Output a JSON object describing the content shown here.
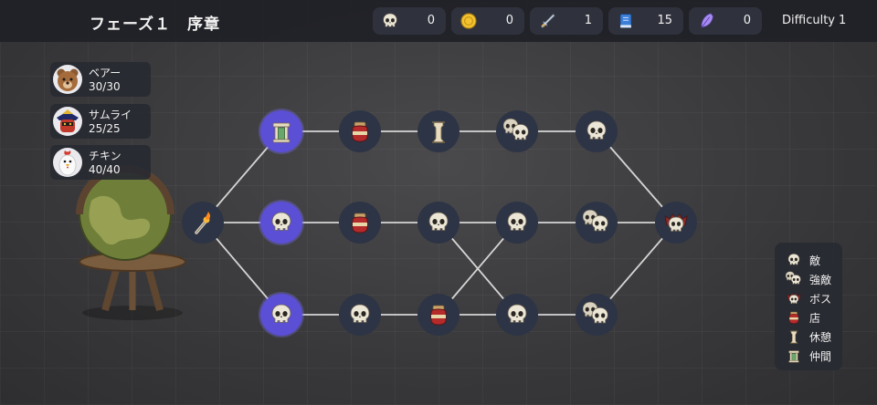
{
  "phase_title": "フェーズ１　序章",
  "resources": [
    {
      "icon": "skull-icon",
      "value": "0"
    },
    {
      "icon": "gold-coin-icon",
      "value": "0"
    },
    {
      "icon": "sword-icon",
      "value": "1"
    },
    {
      "icon": "spellbook-icon",
      "value": "15"
    },
    {
      "icon": "feather-icon",
      "value": "0"
    }
  ],
  "difficulty": {
    "label": "Difficulty",
    "value": "1"
  },
  "party": [
    {
      "name": "ベアー",
      "hp": "30/30",
      "portrait": "bear-portrait"
    },
    {
      "name": "サムライ",
      "hp": "25/25",
      "portrait": "samurai-portrait"
    },
    {
      "name": "チキン",
      "hp": "40/40",
      "portrait": "chicken-portrait"
    }
  ],
  "map": {
    "start": {
      "icon": "torch-icon"
    },
    "paths": [
      [
        "ally",
        "shop",
        "rest",
        "elite",
        "enemy"
      ],
      [
        "enemy",
        "shop",
        "enemy",
        "enemy",
        "elite"
      ],
      [
        "enemy",
        "enemy",
        "shop",
        "enemy",
        "elite"
      ]
    ],
    "boss": {
      "icon": "boss-icon"
    },
    "active_column": 1
  },
  "legend": [
    {
      "icon": "enemy",
      "label": "敵"
    },
    {
      "icon": "elite",
      "label": "強敵"
    },
    {
      "icon": "boss",
      "label": "ボス"
    },
    {
      "icon": "shop",
      "label": "店"
    },
    {
      "icon": "rest",
      "label": "休憩"
    },
    {
      "icon": "ally",
      "label": "仲間"
    }
  ],
  "colors": {
    "active_node": "#5b4fd6",
    "node": "#2d3445",
    "panel": "#282a32"
  }
}
